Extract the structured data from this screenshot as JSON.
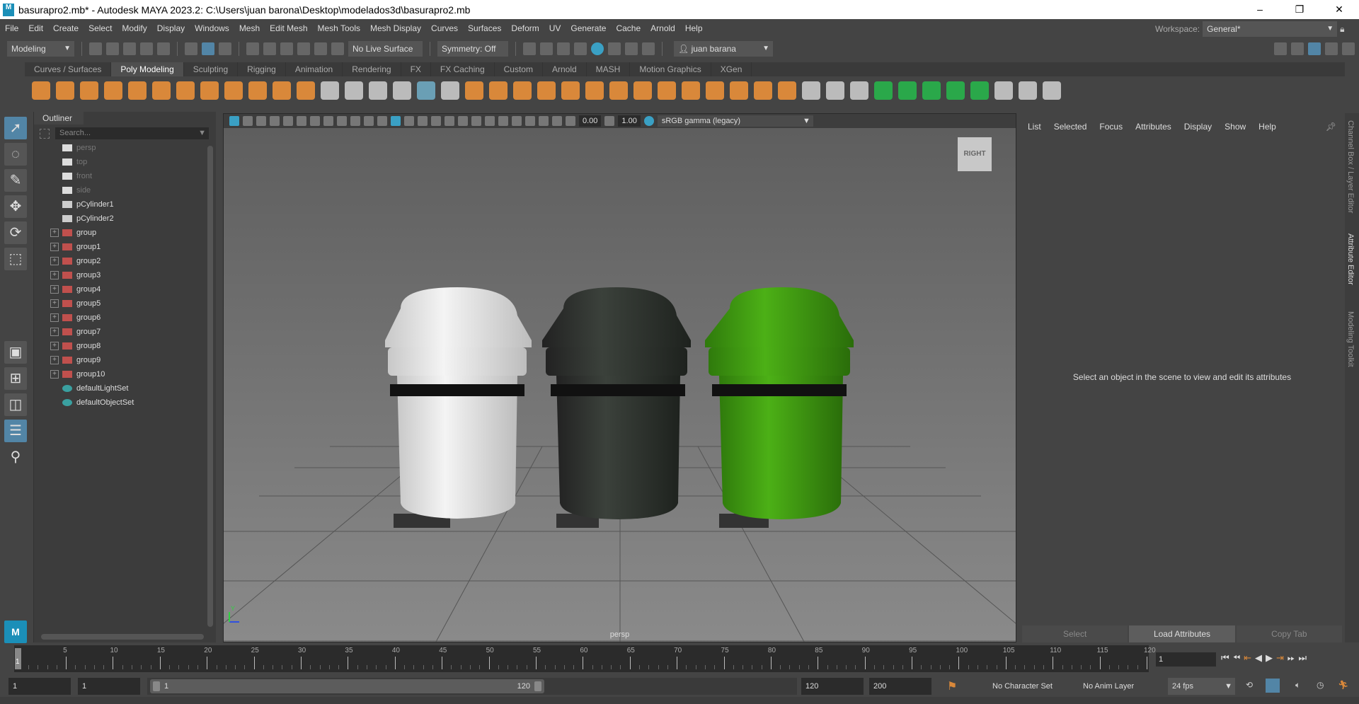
{
  "window": {
    "title": "basurapro2.mb* - Autodesk MAYA 2023.2: C:\\Users\\juan barona\\Desktop\\modelados3d\\basurapro2.mb",
    "logo": "M",
    "controls": [
      "–",
      "❐",
      "✕"
    ]
  },
  "menu": [
    "File",
    "Edit",
    "Create",
    "Select",
    "Modify",
    "Display",
    "Windows",
    "Mesh",
    "Edit Mesh",
    "Mesh Tools",
    "Mesh Display",
    "Curves",
    "Surfaces",
    "Deform",
    "UV",
    "Generate",
    "Cache",
    "Arnold",
    "Help"
  ],
  "workspace": {
    "label": "Workspace:",
    "value": "General*"
  },
  "status": {
    "mode": "Modeling",
    "live_surface": "No Live Surface",
    "symmetry": "Symmetry: Off",
    "user": "juan barana"
  },
  "shelf_tabs": [
    "Curves / Surfaces",
    "Poly Modeling",
    "Sculpting",
    "Rigging",
    "Animation",
    "Rendering",
    "FX",
    "FX Caching",
    "Custom",
    "Arnold",
    "MASH",
    "Motion Graphics",
    "XGen"
  ],
  "shelf_active": "Poly Modeling",
  "outliner": {
    "title": "Outliner",
    "search_placeholder": "Search...",
    "items": [
      {
        "name": "persp",
        "type": "camera",
        "dim": true
      },
      {
        "name": "top",
        "type": "camera",
        "dim": true
      },
      {
        "name": "front",
        "type": "camera",
        "dim": true
      },
      {
        "name": "side",
        "type": "camera",
        "dim": true
      },
      {
        "name": "pCylinder1",
        "type": "mesh"
      },
      {
        "name": "pCylinder2",
        "type": "mesh"
      },
      {
        "name": "group",
        "type": "group"
      },
      {
        "name": "group1",
        "type": "group"
      },
      {
        "name": "group2",
        "type": "group"
      },
      {
        "name": "group3",
        "type": "group"
      },
      {
        "name": "group4",
        "type": "group"
      },
      {
        "name": "group5",
        "type": "group"
      },
      {
        "name": "group6",
        "type": "group"
      },
      {
        "name": "group7",
        "type": "group"
      },
      {
        "name": "group8",
        "type": "group"
      },
      {
        "name": "group9",
        "type": "group"
      },
      {
        "name": "group10",
        "type": "group"
      },
      {
        "name": "defaultLightSet",
        "type": "set"
      },
      {
        "name": "defaultObjectSet",
        "type": "set"
      }
    ]
  },
  "viewport": {
    "exposure": "0.00",
    "gamma": "1.00",
    "color_space": "sRGB gamma (legacy)",
    "camera_label": "persp",
    "view_cube": "RIGHT",
    "axis_y": "Y"
  },
  "attribute_editor": {
    "menu": [
      "List",
      "Selected",
      "Focus",
      "Attributes",
      "Display",
      "Show",
      "Help"
    ],
    "message": "Select an object in the scene to view and edit its attributes",
    "buttons": [
      "Select",
      "Load Attributes",
      "Copy Tab"
    ]
  },
  "side_tabs": [
    "Channel Box / Layer Editor",
    "Attribute Editor",
    "Modeling Toolkit"
  ],
  "timeline": {
    "ticks": [
      "5",
      "10",
      "15",
      "20",
      "25",
      "30",
      "35",
      "40",
      "45",
      "50",
      "55",
      "60",
      "65",
      "70",
      "75",
      "80",
      "85",
      "90",
      "95",
      "100",
      "105",
      "110",
      "115",
      "120"
    ],
    "current_frame": "1",
    "start_marker": "1"
  },
  "range": {
    "start": "1",
    "playback_start": "1",
    "slider_start": "1",
    "slider_end": "120",
    "playback_end": "120",
    "end": "200",
    "character_set": "No Character Set",
    "anim_layer": "No Anim Layer",
    "fps": "24 fps"
  },
  "colors": {
    "accent": "#5285a6",
    "bin_white": "#e8e8e8",
    "bin_black": "#2e332e",
    "bin_green": "#3f9a12"
  }
}
